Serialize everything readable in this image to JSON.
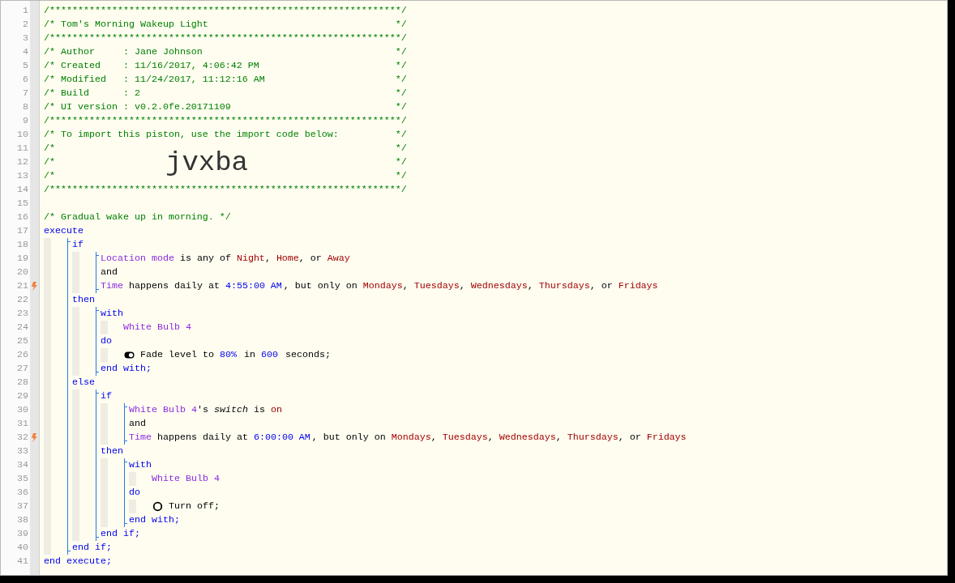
{
  "line_numbers": [
    "1",
    "2",
    "3",
    "4",
    "5",
    "6",
    "7",
    "8",
    "9",
    "10",
    "11",
    "12",
    "13",
    "14",
    "15",
    "16",
    "17",
    "18",
    "19",
    "20",
    "21",
    "22",
    "23",
    "24",
    "25",
    "26",
    "27",
    "28",
    "29",
    "30",
    "31",
    "32",
    "33",
    "34",
    "35",
    "36",
    "37",
    "38",
    "39",
    "40",
    "41"
  ],
  "header": [
    {
      "kind": "comment",
      "text": "/**************************************************************/"
    },
    {
      "kind": "comment",
      "text": "/* Tom's Morning Wakeup Light",
      "end": "*/"
    },
    {
      "kind": "comment",
      "text": "/**************************************************************/"
    },
    {
      "kind": "comment",
      "text": "/* Author     : Jane Johnson",
      "end": "*/"
    },
    {
      "kind": "comment",
      "text": "/* Created    : 11/16/2017, 4:06:42 PM",
      "end": "*/"
    },
    {
      "kind": "comment",
      "text": "/* Modified   : 11/24/2017, 11:12:16 AM",
      "end": "*/"
    },
    {
      "kind": "comment",
      "text": "/* Build      : 2",
      "end": "*/"
    },
    {
      "kind": "comment",
      "text": "/* UI version : v0.2.0fe.20171109",
      "end": "*/"
    },
    {
      "kind": "comment",
      "text": "/**************************************************************/"
    },
    {
      "kind": "comment",
      "text": "/* To import this piston, use the import code below:",
      "end": "*/"
    },
    {
      "kind": "comment",
      "text": "/*",
      "end": "*/"
    },
    {
      "kind": "import",
      "text": "/*",
      "code": "jvxba",
      "end": "*/"
    },
    {
      "kind": "comment",
      "text": "/*",
      "end": "*/"
    },
    {
      "kind": "comment",
      "text": "/**************************************************************/"
    },
    {
      "kind": "blank"
    },
    {
      "kind": "comment",
      "text": "/* Gradual wake up in morning. */"
    }
  ],
  "program": [
    {
      "kind": "line",
      "trigger": false,
      "tokens": [
        {
          "t": "execute",
          "kind": "keyword"
        }
      ]
    },
    {
      "kind": "block",
      "bracket": true,
      "children": [
        {
          "kind": "line",
          "trigger": false,
          "tokens": [
            {
              "t": "if",
              "kind": "keyword"
            }
          ]
        },
        {
          "kind": "block",
          "bracket": true,
          "children": [
            {
              "kind": "line",
              "trigger": false,
              "tokens": [
                {
                  "t": "Location mode",
                  "kind": "device"
                },
                {
                  "t": " is any of ",
                  "kind": "plain"
                },
                {
                  "t": "Night",
                  "kind": "value"
                },
                {
                  "t": ", ",
                  "kind": "plain"
                },
                {
                  "t": "Home",
                  "kind": "value"
                },
                {
                  "t": ", or ",
                  "kind": "plain"
                },
                {
                  "t": "Away",
                  "kind": "value"
                }
              ]
            },
            {
              "kind": "line",
              "trigger": false,
              "tokens": [
                {
                  "t": "and",
                  "kind": "plain"
                }
              ]
            },
            {
              "kind": "line",
              "trigger": true,
              "tokens": [
                {
                  "t": "Time",
                  "kind": "device"
                },
                {
                  "t": " happens daily at ",
                  "kind": "plain"
                },
                {
                  "t": "4:55:00 AM",
                  "kind": "number"
                },
                {
                  "t": ", but only on ",
                  "kind": "plain"
                },
                {
                  "t": "Mondays",
                  "kind": "value"
                },
                {
                  "t": ", ",
                  "kind": "plain"
                },
                {
                  "t": "Tuesdays",
                  "kind": "value"
                },
                {
                  "t": ", ",
                  "kind": "plain"
                },
                {
                  "t": "Wednesdays",
                  "kind": "value"
                },
                {
                  "t": ", ",
                  "kind": "plain"
                },
                {
                  "t": "Thursdays",
                  "kind": "value"
                },
                {
                  "t": ", or ",
                  "kind": "plain"
                },
                {
                  "t": "Fridays",
                  "kind": "value"
                }
              ]
            }
          ]
        },
        {
          "kind": "line",
          "trigger": false,
          "tokens": [
            {
              "t": "then",
              "kind": "keyword"
            }
          ]
        },
        {
          "kind": "block",
          "bracket": true,
          "children": [
            {
              "kind": "line",
              "trigger": false,
              "tokens": [
                {
                  "t": "with",
                  "kind": "keyword"
                }
              ]
            },
            {
              "kind": "block",
              "bracket": false,
              "children": [
                {
                  "kind": "line",
                  "trigger": false,
                  "tokens": [
                    {
                      "t": "White Bulb 4",
                      "kind": "device"
                    }
                  ]
                }
              ]
            },
            {
              "kind": "line",
              "trigger": false,
              "tokens": [
                {
                  "t": "do",
                  "kind": "keyword"
                }
              ]
            },
            {
              "kind": "block",
              "bracket": false,
              "children": [
                {
                  "kind": "line",
                  "trigger": false,
                  "tokens": [
                    {
                      "kind": "fade-icon"
                    },
                    {
                      "t": " Fade level to ",
                      "kind": "plain"
                    },
                    {
                      "t": "80%",
                      "kind": "number"
                    },
                    {
                      "t": " in ",
                      "kind": "plain"
                    },
                    {
                      "t": "600",
                      "kind": "number"
                    },
                    {
                      "t": " seconds;",
                      "kind": "plain"
                    }
                  ]
                }
              ]
            },
            {
              "kind": "line",
              "trigger": false,
              "tokens": [
                {
                  "t": "end with;",
                  "kind": "keyword"
                }
              ]
            }
          ]
        },
        {
          "kind": "line",
          "trigger": false,
          "tokens": [
            {
              "t": "else",
              "kind": "keyword"
            }
          ]
        },
        {
          "kind": "block",
          "bracket": true,
          "children": [
            {
              "kind": "line",
              "trigger": false,
              "tokens": [
                {
                  "t": "if",
                  "kind": "keyword"
                }
              ]
            },
            {
              "kind": "block",
              "bracket": true,
              "children": [
                {
                  "kind": "line",
                  "trigger": false,
                  "tokens": [
                    {
                      "t": "White Bulb 4",
                      "kind": "device"
                    },
                    {
                      "t": "'s ",
                      "kind": "plain"
                    },
                    {
                      "t": "switch",
                      "kind": "attribute"
                    },
                    {
                      "t": " is ",
                      "kind": "plain"
                    },
                    {
                      "t": "on",
                      "kind": "value"
                    }
                  ]
                },
                {
                  "kind": "line",
                  "trigger": false,
                  "tokens": [
                    {
                      "t": "and",
                      "kind": "plain"
                    }
                  ]
                },
                {
                  "kind": "line",
                  "trigger": true,
                  "tokens": [
                    {
                      "t": "Time",
                      "kind": "device"
                    },
                    {
                      "t": " happens daily at ",
                      "kind": "plain"
                    },
                    {
                      "t": "6:00:00 AM",
                      "kind": "number"
                    },
                    {
                      "t": ", but only on ",
                      "kind": "plain"
                    },
                    {
                      "t": "Mondays",
                      "kind": "value"
                    },
                    {
                      "t": ", ",
                      "kind": "plain"
                    },
                    {
                      "t": "Tuesdays",
                      "kind": "value"
                    },
                    {
                      "t": ", ",
                      "kind": "plain"
                    },
                    {
                      "t": "Wednesdays",
                      "kind": "value"
                    },
                    {
                      "t": ", ",
                      "kind": "plain"
                    },
                    {
                      "t": "Thursdays",
                      "kind": "value"
                    },
                    {
                      "t": ", or ",
                      "kind": "plain"
                    },
                    {
                      "t": "Fridays",
                      "kind": "value"
                    }
                  ]
                }
              ]
            },
            {
              "kind": "line",
              "trigger": false,
              "tokens": [
                {
                  "t": "then",
                  "kind": "keyword"
                }
              ]
            },
            {
              "kind": "block",
              "bracket": true,
              "children": [
                {
                  "kind": "line",
                  "trigger": false,
                  "tokens": [
                    {
                      "t": "with",
                      "kind": "keyword"
                    }
                  ]
                },
                {
                  "kind": "block",
                  "bracket": false,
                  "children": [
                    {
                      "kind": "line",
                      "trigger": false,
                      "tokens": [
                        {
                          "t": "White Bulb 4",
                          "kind": "device"
                        }
                      ]
                    }
                  ]
                },
                {
                  "kind": "line",
                  "trigger": false,
                  "tokens": [
                    {
                      "t": "do",
                      "kind": "keyword"
                    }
                  ]
                },
                {
                  "kind": "block",
                  "bracket": false,
                  "children": [
                    {
                      "kind": "line",
                      "trigger": false,
                      "tokens": [
                        {
                          "kind": "power-icon"
                        },
                        {
                          "t": " Turn off;",
                          "kind": "plain"
                        }
                      ]
                    }
                  ]
                },
                {
                  "kind": "line",
                  "trigger": false,
                  "tokens": [
                    {
                      "t": "end with;",
                      "kind": "keyword"
                    }
                  ]
                }
              ]
            },
            {
              "kind": "line",
              "trigger": false,
              "tokens": [
                {
                  "t": "end if;",
                  "kind": "keyword"
                }
              ]
            }
          ]
        },
        {
          "kind": "line",
          "trigger": false,
          "tokens": [
            {
              "t": "end if;",
              "kind": "keyword"
            }
          ]
        }
      ]
    },
    {
      "kind": "line",
      "trigger": false,
      "tokens": [
        {
          "t": "end execute;",
          "kind": "keyword"
        }
      ]
    }
  ]
}
